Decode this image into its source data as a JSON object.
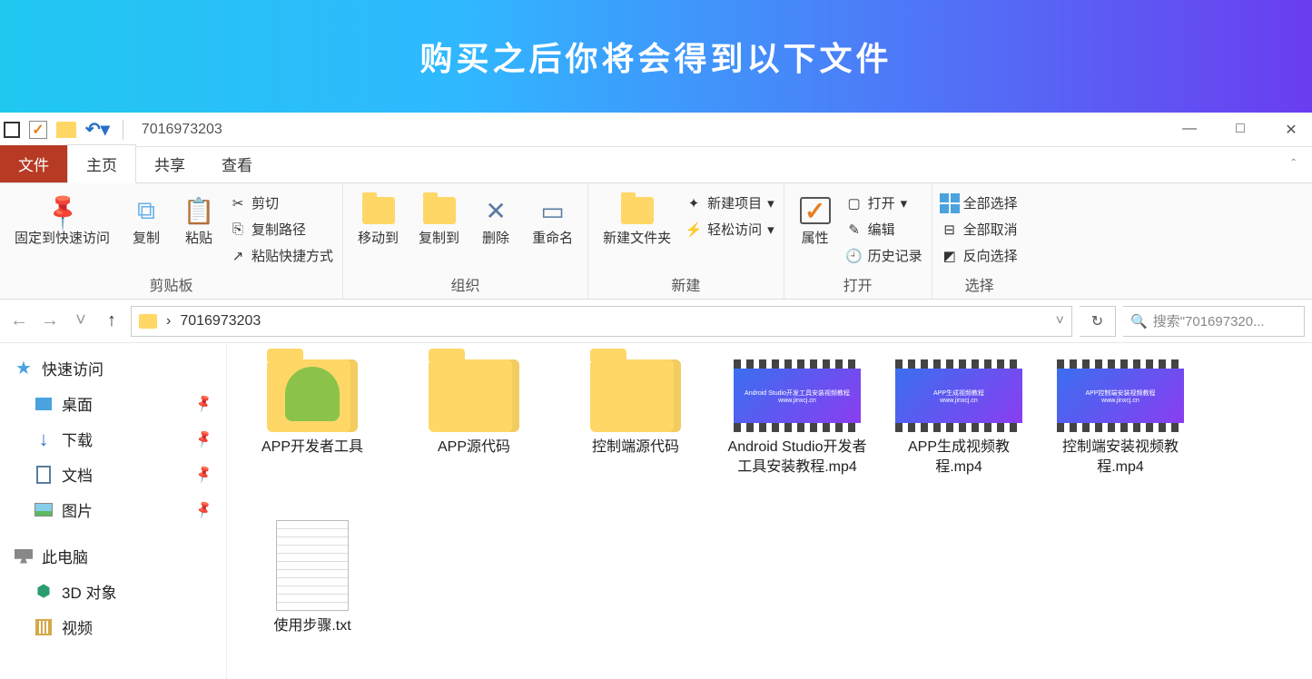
{
  "banner": {
    "title": "购买之后你将会得到以下文件"
  },
  "titlebar": {
    "title": "7016973203",
    "controls": {
      "min": "—",
      "max": "□",
      "close": "✕"
    }
  },
  "tabs": {
    "file": "文件",
    "home": "主页",
    "share": "共享",
    "view": "查看"
  },
  "ribbon": {
    "clipboard": {
      "label": "剪贴板",
      "pin": "固定到快速访问",
      "copy": "复制",
      "paste": "粘贴",
      "cut": "剪切",
      "copypath": "复制路径",
      "pasteshortcut": "粘贴快捷方式"
    },
    "organize": {
      "label": "组织",
      "moveto": "移动到",
      "copyto": "复制到",
      "delete": "删除",
      "rename": "重命名"
    },
    "new": {
      "label": "新建",
      "newfolder": "新建文件夹",
      "newitem": "新建项目",
      "easyaccess": "轻松访问"
    },
    "open": {
      "label": "打开",
      "properties": "属性",
      "open": "打开",
      "edit": "编辑",
      "history": "历史记录"
    },
    "select": {
      "label": "选择",
      "selectall": "全部选择",
      "selectnone": "全部取消",
      "invert": "反向选择"
    }
  },
  "nav": {
    "crumb_sep": "›",
    "crumb": "7016973203",
    "search_placeholder": "搜索\"701697320..."
  },
  "sidebar": {
    "quickaccess": "快速访问",
    "desktop": "桌面",
    "downloads": "下载",
    "documents": "文档",
    "pictures": "图片",
    "thispc": "此电脑",
    "objects3d": "3D 对象",
    "videos": "视频"
  },
  "files": [
    {
      "name": "APP开发者工具",
      "type": "folder-android"
    },
    {
      "name": "APP源代码",
      "type": "folder"
    },
    {
      "name": "控制端源代码",
      "type": "folder"
    },
    {
      "name": "Android Studio开发者工具安装教程.mp4",
      "type": "video",
      "caption": "Android Studio开发工具安装视频教程"
    },
    {
      "name": "APP生成视频教程.mp4",
      "type": "video",
      "caption": "APP生成视频教程"
    },
    {
      "name": "控制端安装视频教程.mp4",
      "type": "video",
      "caption": "APP控制端安装视频教程"
    },
    {
      "name": "使用步骤.txt",
      "type": "txt"
    }
  ]
}
